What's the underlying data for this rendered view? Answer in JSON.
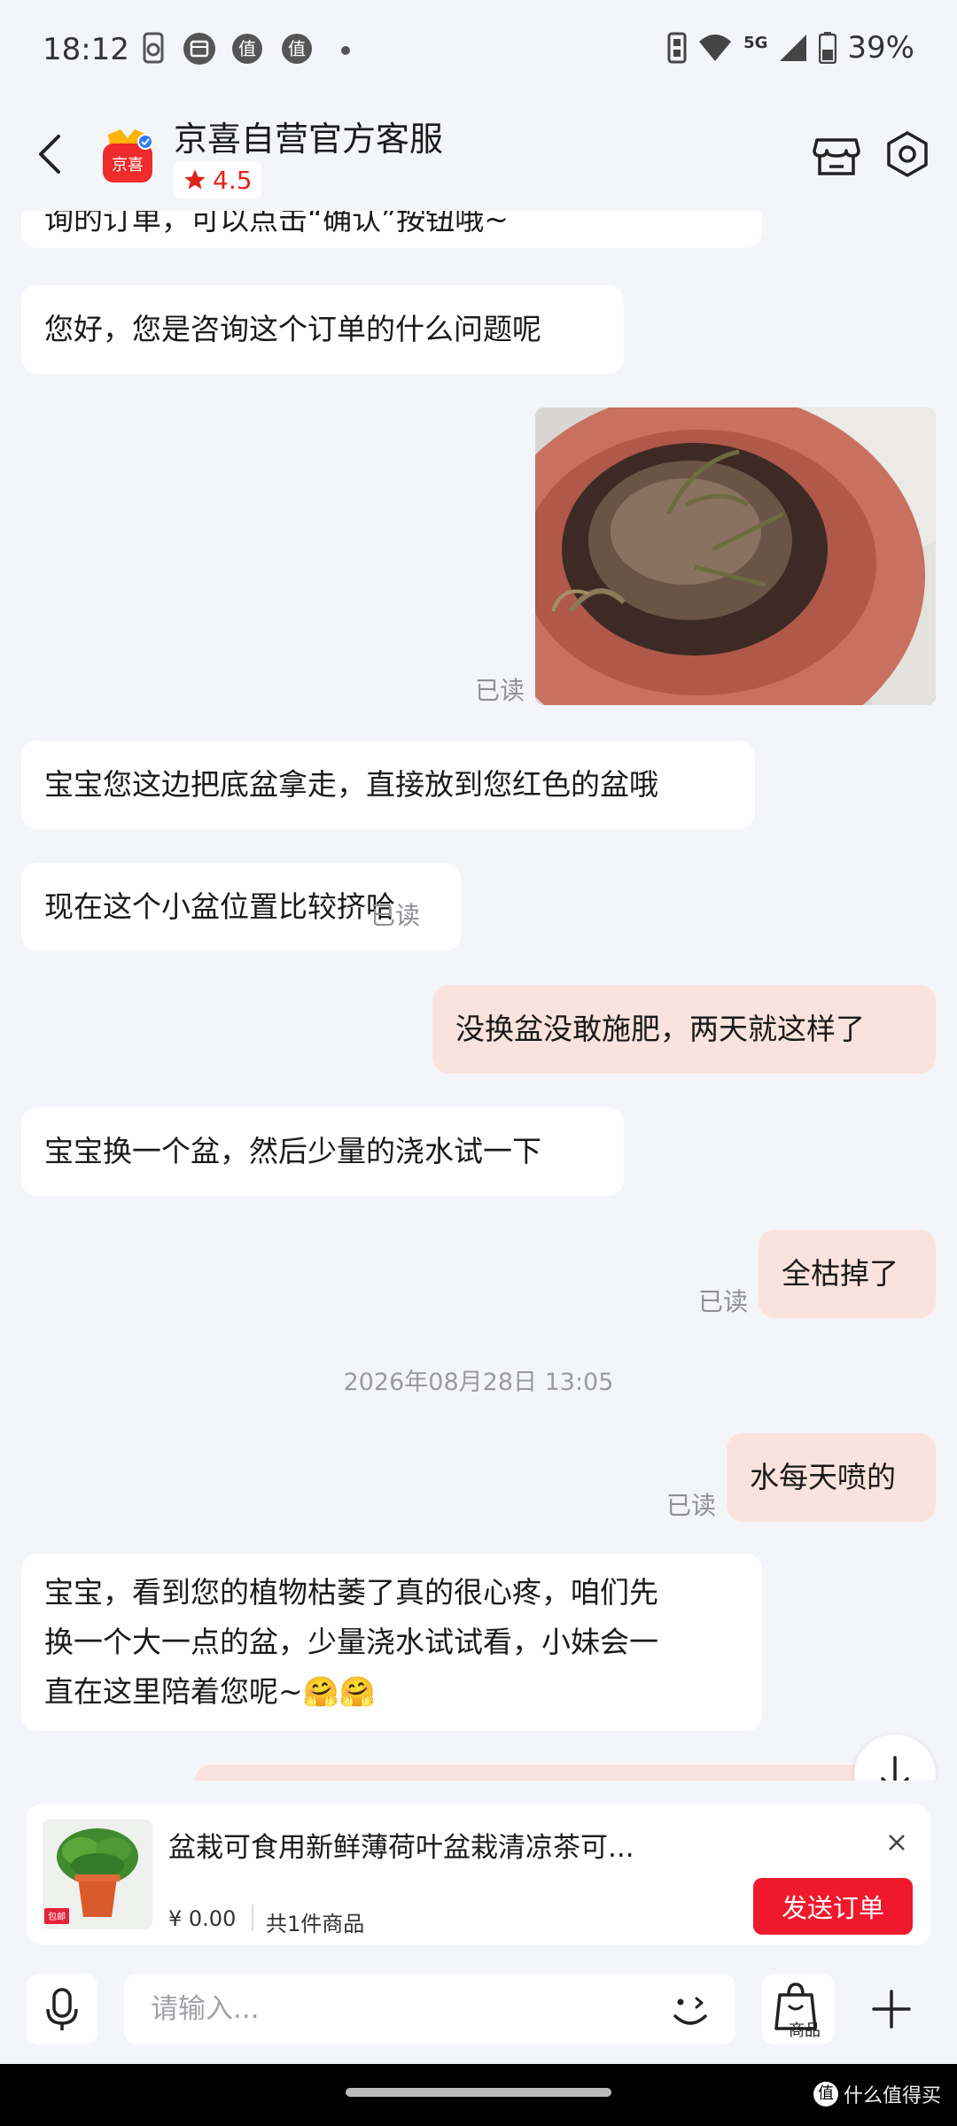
{
  "status_bar": {
    "time": "18:12",
    "network": "5G",
    "battery": "39%",
    "notif_icon_labels": [
      "值",
      "值"
    ]
  },
  "header": {
    "shop_name": "京喜自营官方客服",
    "logo_text": "京喜",
    "rating": "4.5"
  },
  "messages": {
    "partial_top": "询的订单，可以点击“确认”按钮哦~",
    "m1": "您好，您是咨询这个订单的什么问题呢",
    "read_label": "已读",
    "m2": "宝宝您这边把底盆拿走，直接放到您红色的盆哦",
    "m3": "现在这个小盆位置比较挤哈",
    "m4": "没换盆没敢施肥，两天就这样了",
    "m5": "宝宝换一个盆，然后少量的浇水试一下",
    "m6": "全枯掉了",
    "timestamp": "2026年08月28日 13:05",
    "m7": "水每天喷的",
    "m8_line1": "宝宝，看到您的植物枯萎了真的很心疼，咱们先",
    "m8_line2": "换一个大一点的盆，少量浇水试试看，小妹会一",
    "m8_line3": "直在这里陪着您呢~🤗🤗"
  },
  "product_card": {
    "title": "盆栽可食用新鲜薄荷叶盆栽清凉茶可...",
    "price": "¥ 0.00",
    "count": "共1件商品",
    "send_button": "发送订单",
    "thumb_badge": "包邮"
  },
  "input_bar": {
    "placeholder": "请输入...",
    "goods_label": "商品"
  },
  "watermark": {
    "icon": "值",
    "text": "什么值得买"
  },
  "colors": {
    "accent_red": "#f0182c",
    "outgoing_bubble": "#fbe3dd",
    "incoming_bubble": "#ffffff",
    "background": "#f4f5f9"
  }
}
